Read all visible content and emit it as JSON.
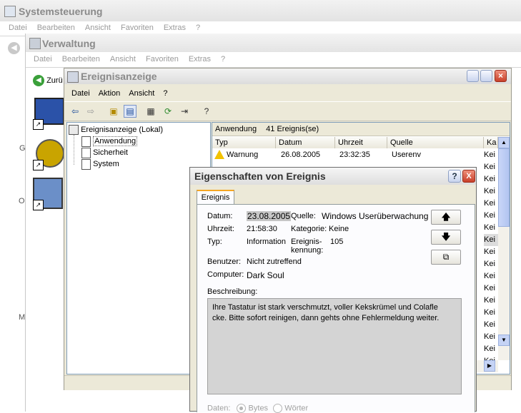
{
  "systemsteuerung": {
    "title": "Systemsteuerung",
    "menu": [
      "Datei",
      "Bearbeiten",
      "Ansicht",
      "Favoriten",
      "Extras",
      "?"
    ],
    "side_letters": [
      "G",
      "O",
      "M"
    ]
  },
  "verwaltung": {
    "title": "Verwaltung",
    "menu": [
      "Datei",
      "Bearbeiten",
      "Ansicht",
      "Favoriten",
      "Extras",
      "?"
    ],
    "back_label": "Zurü"
  },
  "ereignisanzeige": {
    "title": "Ereignisanzeige",
    "menu": [
      "Datei",
      "Aktion",
      "Ansicht",
      "?"
    ],
    "tree": {
      "root": "Ereignisanzeige (Lokal)",
      "children": [
        "Anwendung",
        "Sicherheit",
        "System"
      ],
      "selected": "Anwendung"
    },
    "list_header": {
      "name": "Anwendung",
      "count": "41 Ereignis(se)"
    },
    "columns": [
      "Typ",
      "Datum",
      "Uhrzeit",
      "Quelle",
      "Ka"
    ],
    "rows": [
      {
        "typ": "Warnung",
        "datum": "26.08.2005",
        "uhrzeit": "23:32:35",
        "quelle": "Userenv",
        "kat": "Kei"
      }
    ],
    "kat_values": [
      "Kei",
      "Kei",
      "Kei",
      "Kei",
      "Kei",
      "Kei",
      "Kei",
      "Kei",
      "Kei",
      "Kei",
      "Kei",
      "Kei",
      "Kei",
      "Kei",
      "Kei",
      "Kei",
      "Kei",
      "Kei"
    ]
  },
  "dialog": {
    "title": "Eigenschaften von Ereignis",
    "help_glyph": "?",
    "close_glyph": "X",
    "tab": "Ereignis",
    "datum_label": "Datum:",
    "datum_value": "23.08.2005",
    "quelle_label": "Quelle:",
    "quelle_value": "Windows Userüberwachung",
    "uhrzeit_label": "Uhrzeit:",
    "uhrzeit_value": "21:58:30",
    "kategorie_label": "Kategorie:",
    "kategorie_value": "Keine",
    "typ_label": "Typ:",
    "typ_value": "Information",
    "kennung_label_1": "Ereignis-",
    "kennung_label_2": "kennung:",
    "kennung_value": "105",
    "benutzer_label": "Benutzer:",
    "benutzer_value": "Nicht zutreffend",
    "computer_label": "Computer:",
    "computer_value": "Dark Soul",
    "beschreibung_label": "Beschreibung:",
    "beschreibung_text_1": "Ihre Tastatur ist stark verschmutzt, voller Kekskrümel und Colafle",
    "beschreibung_text_2": "cke. Bitte sofort reinigen, dann gehts ohne Fehlermeldung weiter.",
    "daten_label": "Daten:",
    "bytes_label": "Bytes",
    "woerter_label": "Wörter",
    "btn_up": "🡅",
    "btn_down": "🡇",
    "btn_copy": "⧉"
  }
}
